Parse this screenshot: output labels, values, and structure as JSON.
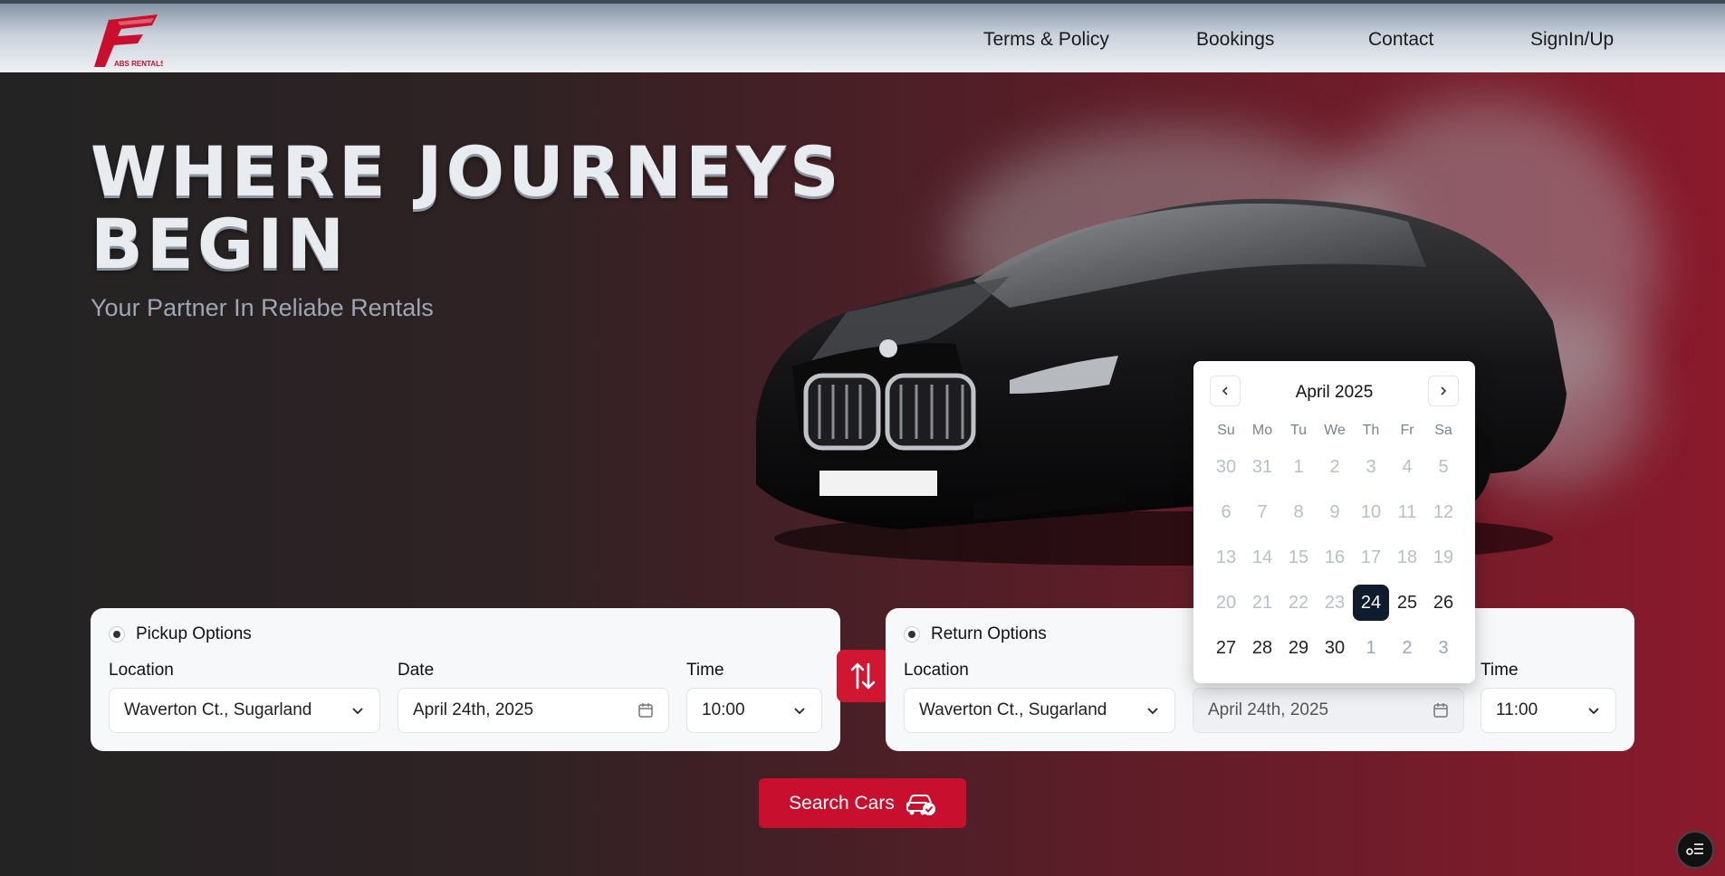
{
  "brand": {
    "logo_text": "ABS RENTALS",
    "accent_color": "#c8102e"
  },
  "nav": {
    "items": [
      "Terms & Policy",
      "Bookings",
      "Contact",
      "SignIn/Up"
    ]
  },
  "hero": {
    "headline_line1": "WHERE JOURNEYS",
    "headline_line2": "BEGIN",
    "subtitle": "Your Partner In Reliabe Rentals"
  },
  "pickup": {
    "title": "Pickup Options",
    "location_label": "Location",
    "location_value": "Waverton Ct., Sugarland",
    "date_label": "Date",
    "date_value": "April 24th, 2025",
    "time_label": "Time",
    "time_value": "10:00"
  },
  "return": {
    "title": "Return Options",
    "location_label": "Location",
    "location_value": "Waverton Ct., Sugarland",
    "date_value": "April 24th, 2025",
    "time_label": "Time",
    "time_value": "11:00"
  },
  "search_button": {
    "label": "Search Cars"
  },
  "calendar": {
    "month": "April 2025",
    "weekdays": [
      "Su",
      "Mo",
      "Tu",
      "We",
      "Th",
      "Fr",
      "Sa"
    ],
    "weeks": [
      [
        "30",
        "31",
        "1",
        "2",
        "3",
        "4",
        "5"
      ],
      [
        "6",
        "7",
        "8",
        "9",
        "10",
        "11",
        "12"
      ],
      [
        "13",
        "14",
        "15",
        "16",
        "17",
        "18",
        "19"
      ],
      [
        "20",
        "21",
        "22",
        "23",
        "24",
        "25",
        "26"
      ],
      [
        "27",
        "28",
        "29",
        "30",
        "1",
        "2",
        "3"
      ]
    ],
    "selected": "24"
  },
  "icons": {
    "chat": "chat-widget-icon",
    "swap": "swap-arrows-icon",
    "car_check": "car-check-icon",
    "calendar": "calendar-icon",
    "chevron": "chevron-down-icon"
  }
}
